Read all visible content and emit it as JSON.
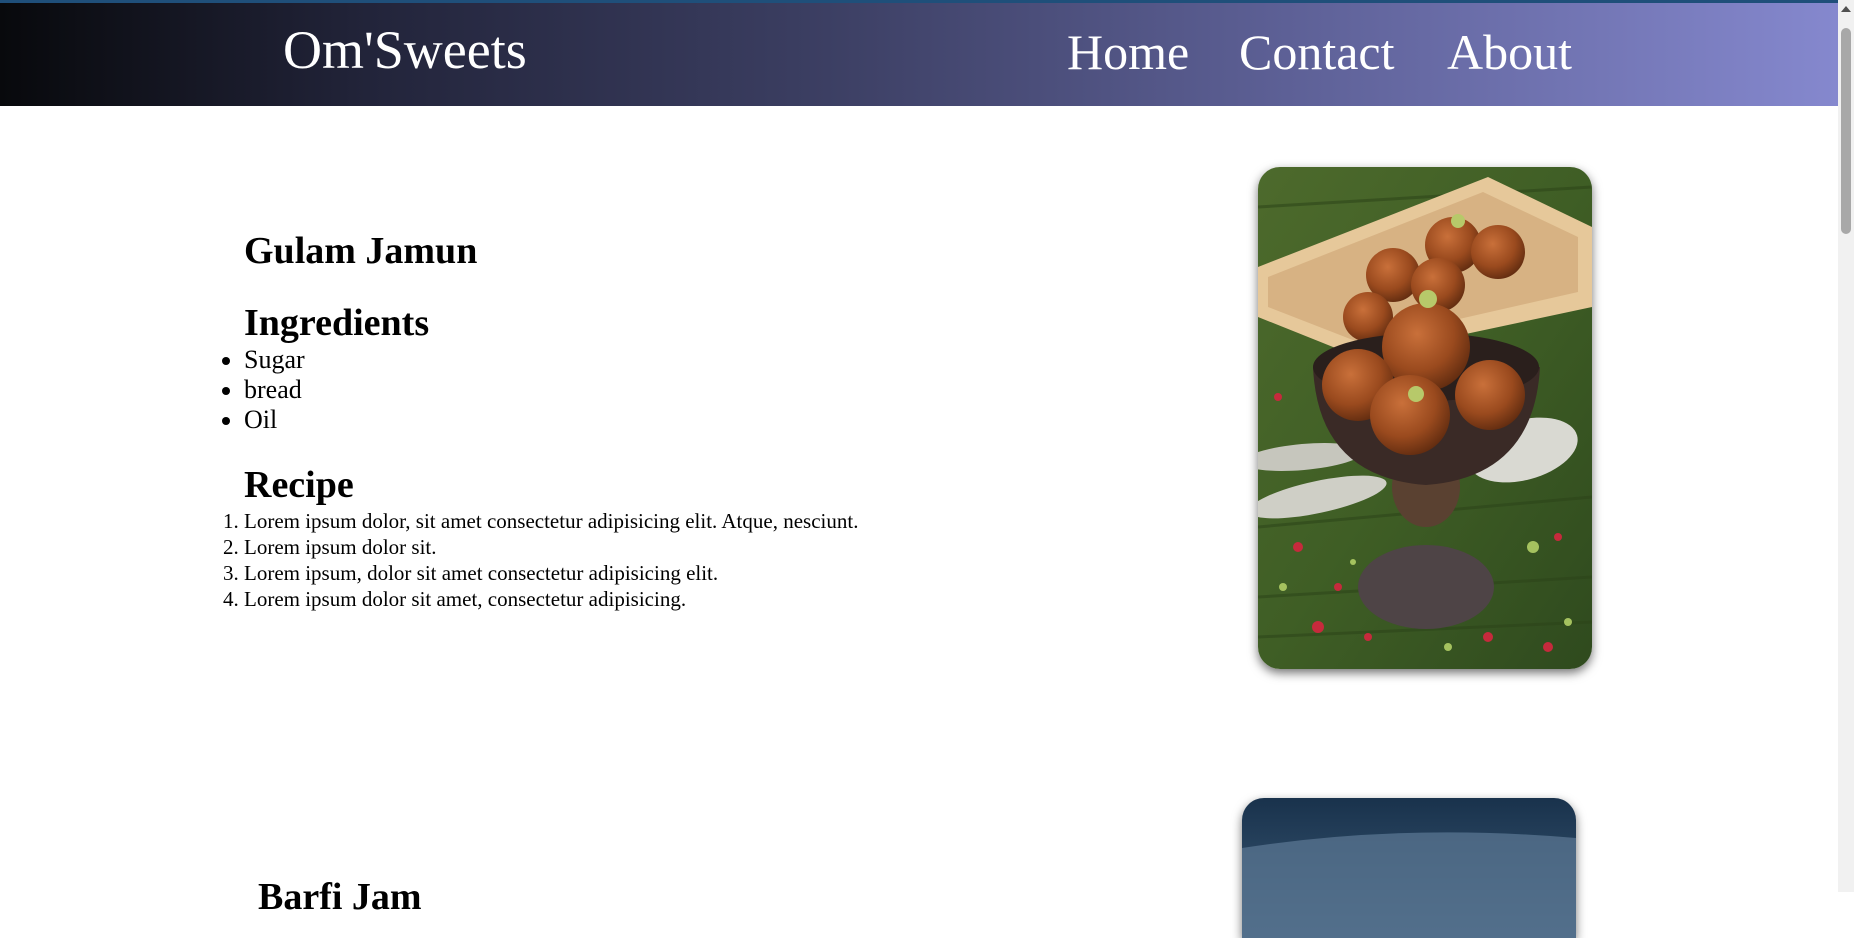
{
  "header": {
    "brand": "Om'Sweets",
    "nav": [
      {
        "label": "Home"
      },
      {
        "label": "Contact"
      },
      {
        "label": "About"
      }
    ]
  },
  "sweets": [
    {
      "name": "Gulam Jamun",
      "ingredients_heading": "Ingredients",
      "ingredients": [
        "Sugar",
        "bread",
        "Oil"
      ],
      "recipe_heading": "Recipe",
      "recipe": [
        "Lorem ipsum dolor, sit amet consectetur adipisicing elit. Atque, nesciunt.",
        "Lorem ipsum dolor sit.",
        "Lorem ipsum, dolor sit amet consectetur adipisicing elit.",
        "Lorem ipsum dolor sit amet, consectetur adipisicing."
      ]
    },
    {
      "name": "Barfi Jam"
    }
  ]
}
